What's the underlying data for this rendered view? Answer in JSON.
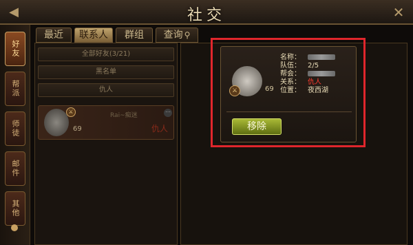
{
  "window": {
    "title": "社交"
  },
  "side_tabs": [
    {
      "label": "好友",
      "active": true
    },
    {
      "label": "帮派",
      "active": false
    },
    {
      "label": "师徒",
      "active": false
    },
    {
      "label": "邮件",
      "active": false
    },
    {
      "label": "其他",
      "active": false
    }
  ],
  "top_tabs": [
    {
      "label": "最近",
      "active": false
    },
    {
      "label": "联系人",
      "active": true
    },
    {
      "label": "群组",
      "active": false
    },
    {
      "label": "查询",
      "active": false,
      "icon": "search-icon"
    }
  ],
  "list": {
    "groups": [
      "全部好友(3/21)",
      "黑名单",
      "仇人"
    ],
    "friend": {
      "name": "Rai~痴迷",
      "level": "69",
      "relation": "仇人"
    }
  },
  "info": {
    "level": "69",
    "fields": [
      {
        "key": "名称：",
        "value": "",
        "blurred": true
      },
      {
        "key": "队伍：",
        "value": "2/5",
        "blurred": false
      },
      {
        "key": "帮会：",
        "value": "",
        "blurred": true
      },
      {
        "key": "关系：",
        "value": "仇人",
        "blurred": false,
        "emphasis": "red"
      },
      {
        "key": "位置：",
        "value": "夜西湖",
        "blurred": false
      }
    ],
    "remove_label": "移除"
  },
  "colors": {
    "highlight": "#e0262c",
    "relation_red": "#ff3b2f",
    "button_green": "#a9b936"
  }
}
